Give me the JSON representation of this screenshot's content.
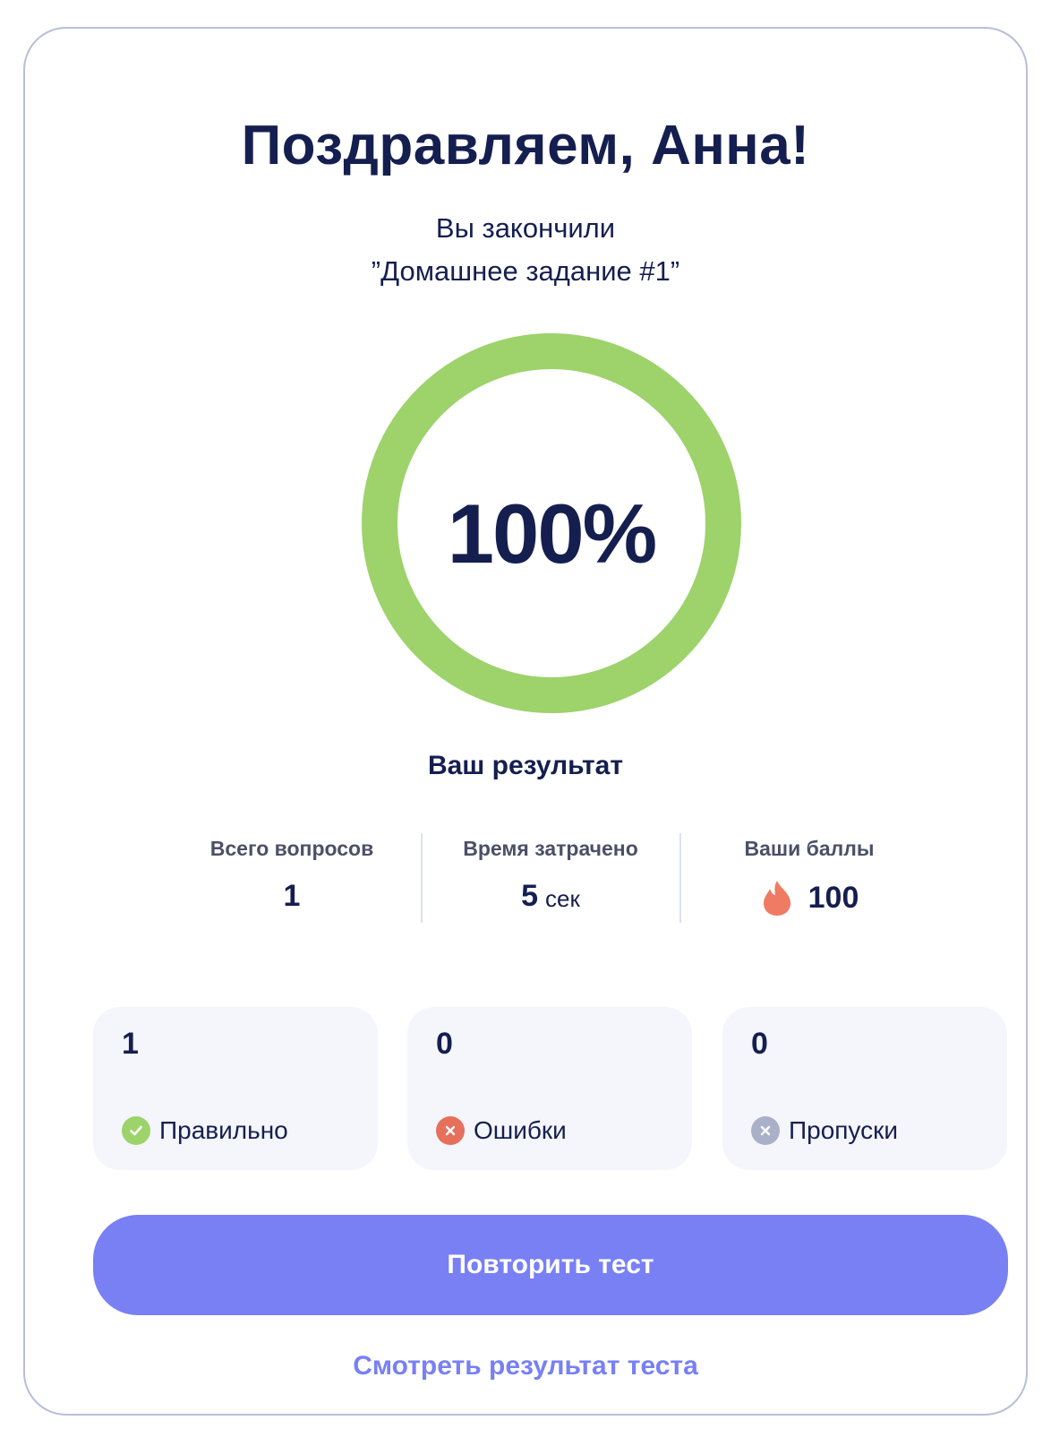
{
  "header": {
    "title": "Поздравляем, Анна!",
    "subtitle_line1": "Вы закончили",
    "subtitle_line2": "”Домашнее задание #1”"
  },
  "score": {
    "value_label": "100%",
    "fraction": 1.0,
    "ring_color": "#9dd36a",
    "result_label": "Ваш результат"
  },
  "stats": {
    "total_questions": {
      "label": "Всего вопросов",
      "value": "1"
    },
    "time_spent": {
      "label": "Время затрачено",
      "value": "5",
      "unit": "сек"
    },
    "points": {
      "label": "Ваши баллы",
      "value": "100",
      "icon": "flame-icon",
      "icon_color": "#ef7b62"
    }
  },
  "tiles": [
    {
      "value": "1",
      "label": "Правильно",
      "icon": "check-icon",
      "icon_color": "#9dd36a"
    },
    {
      "value": "0",
      "label": "Ошибки",
      "icon": "cross-icon",
      "icon_color": "#e6705c"
    },
    {
      "value": "0",
      "label": "Пропуски",
      "icon": "skip-icon",
      "icon_color": "#a9b0c8"
    }
  ],
  "actions": {
    "retry_label": "Повторить тест",
    "view_results_label": "Смотреть результат теста",
    "accent_color": "#7880f4"
  }
}
